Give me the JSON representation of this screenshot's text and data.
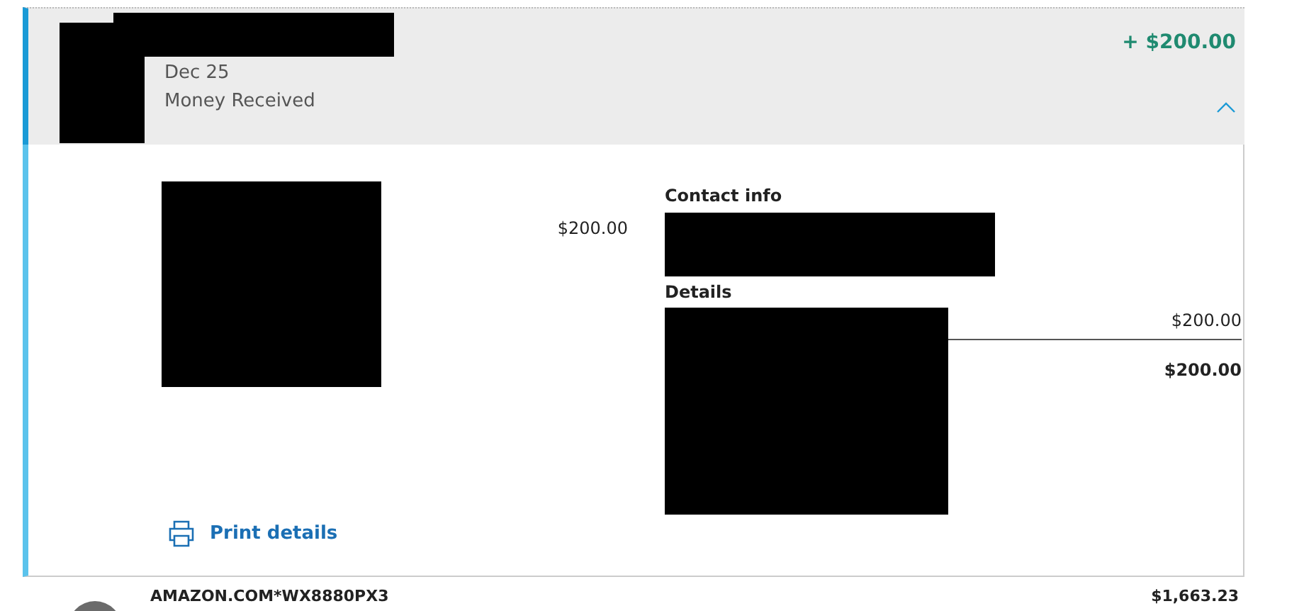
{
  "transaction": {
    "date": "Dec 25",
    "type": "Money Received",
    "amount": "+ $200.00",
    "expanded": true,
    "details": {
      "amount": "$200.00",
      "contact_heading": "Contact info",
      "details_heading": "Details",
      "line_amount": "$200.00",
      "total": "$200.00",
      "print_label": "Print details"
    }
  },
  "next_transaction": {
    "name": "AMAZON.COM*WX8880PX3",
    "amount": "$1,663.23"
  }
}
